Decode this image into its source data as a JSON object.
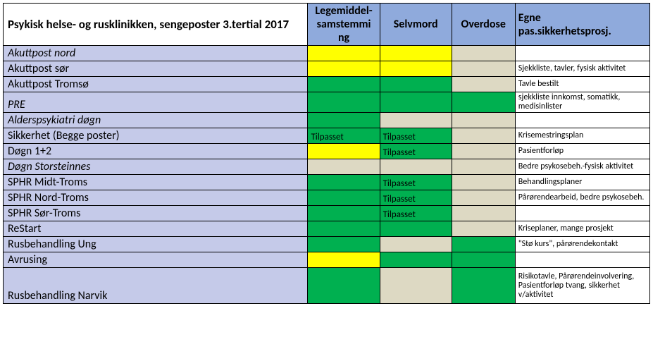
{
  "title": "Psykisk helse- og rusklinikken, sengeposter 3.tertial 2017",
  "headers": {
    "col1": "Legemiddel-samstemming\nng",
    "col1_display": "Legemiddel-\nsamstemmi\nng",
    "col2": "Selvmord",
    "col3": "Overdose",
    "col4": "Egne pas.sikkerhetsprosj."
  },
  "status_labels": {
    "tilpasset": "Tilpasset"
  },
  "rows": [
    {
      "label": "Akuttpost nord",
      "italic": true,
      "c1": {
        "color": "yellow"
      },
      "c2": {
        "color": "yellow"
      },
      "c3": {
        "color": "beige"
      },
      "note": ""
    },
    {
      "label": "Akuttpost sør",
      "italic": false,
      "c1": {
        "color": "yellow"
      },
      "c2": {
        "color": "yellow"
      },
      "c3": {
        "color": "beige"
      },
      "note": "Sjekkliste, tavler, fysisk aktivitet"
    },
    {
      "label": "Akuttpost Tromsø",
      "italic": false,
      "c1": {
        "color": "green"
      },
      "c2": {
        "color": "green"
      },
      "c3": {
        "color": "beige"
      },
      "note": "Tavle bestilt"
    },
    {
      "label": "PRE",
      "italic": true,
      "c1": {
        "color": "green"
      },
      "c2": {
        "color": "green"
      },
      "c3": {
        "color": "green"
      },
      "note": "sjekkliste innkomst, somatikk, medisinlister"
    },
    {
      "label": "Alderspsykiatri døgn",
      "italic": true,
      "c1": {
        "color": "green"
      },
      "c2": {
        "color": "beige"
      },
      "c3": {
        "color": "beige"
      },
      "note": ""
    },
    {
      "label": "Sikkerhet (Begge poster)",
      "italic": false,
      "c1": {
        "color": "green",
        "text": "Tilpasset"
      },
      "c2": {
        "color": "green",
        "text": "Tilpasset"
      },
      "c3": {
        "color": "beige"
      },
      "note": "Krisemestringsplan"
    },
    {
      "label": "Døgn 1+2",
      "italic": false,
      "c1": {
        "color": "yellow"
      },
      "c2": {
        "color": "green",
        "text": "Tilpasset"
      },
      "c3": {
        "color": "beige"
      },
      "note": "Pasientforløp"
    },
    {
      "label": "Døgn Storsteinnes",
      "italic": true,
      "c1": {
        "color": "beige"
      },
      "c2": {
        "color": "beige"
      },
      "c3": {
        "color": "beige"
      },
      "note": "Bedre psykosebeh.-fysisk aktivitet"
    },
    {
      "label": "SPHR Midt-Troms",
      "italic": false,
      "c1": {
        "color": "green"
      },
      "c2": {
        "color": "green",
        "text": "Tilpasset"
      },
      "c3": {
        "color": "beige"
      },
      "note": "Behandlingsplaner"
    },
    {
      "label": "SPHR Nord-Troms",
      "italic": false,
      "c1": {
        "color": "green"
      },
      "c2": {
        "color": "green",
        "text": "Tilpasset"
      },
      "c3": {
        "color": "beige"
      },
      "note": "Pårørendearbeid, bedre psykosebeh."
    },
    {
      "label": "SPHR Sør-Troms",
      "italic": false,
      "c1": {
        "color": "green"
      },
      "c2": {
        "color": "green",
        "text": "Tilpasset"
      },
      "c3": {
        "color": "beige"
      },
      "note": ""
    },
    {
      "label": "ReStart",
      "italic": false,
      "c1": {
        "color": "green"
      },
      "c2": {
        "color": "green"
      },
      "c3": {
        "color": "beige"
      },
      "note": "Kriseplaner, mange prosjekt"
    },
    {
      "label": "Rusbehandling Ung",
      "italic": false,
      "c1": {
        "color": "green"
      },
      "c2": {
        "color": "beige"
      },
      "c3": {
        "color": "green"
      },
      "note": "\"Stø kurs\", pårørendekontakt"
    },
    {
      "label": "Avrusing",
      "italic": false,
      "c1": {
        "color": "yellow"
      },
      "c2": {
        "color": "green"
      },
      "c3": {
        "color": "green"
      },
      "note": ""
    },
    {
      "label": "Rusbehandling Narvik",
      "italic": false,
      "tall": true,
      "c1": {
        "color": "green"
      },
      "c2": {
        "color": "beige"
      },
      "c3": {
        "color": "green"
      },
      "note": "Risikotavle, Pårørendeinvolvering, Pasientforløp tvang, sikkerhet v/aktivitet"
    }
  ],
  "colors": {
    "yellow": "#ffff00",
    "green": "#00b050",
    "beige": "#ddd9c3",
    "header_blue": "#8faadc",
    "row_lavender": "#c5cae9"
  }
}
